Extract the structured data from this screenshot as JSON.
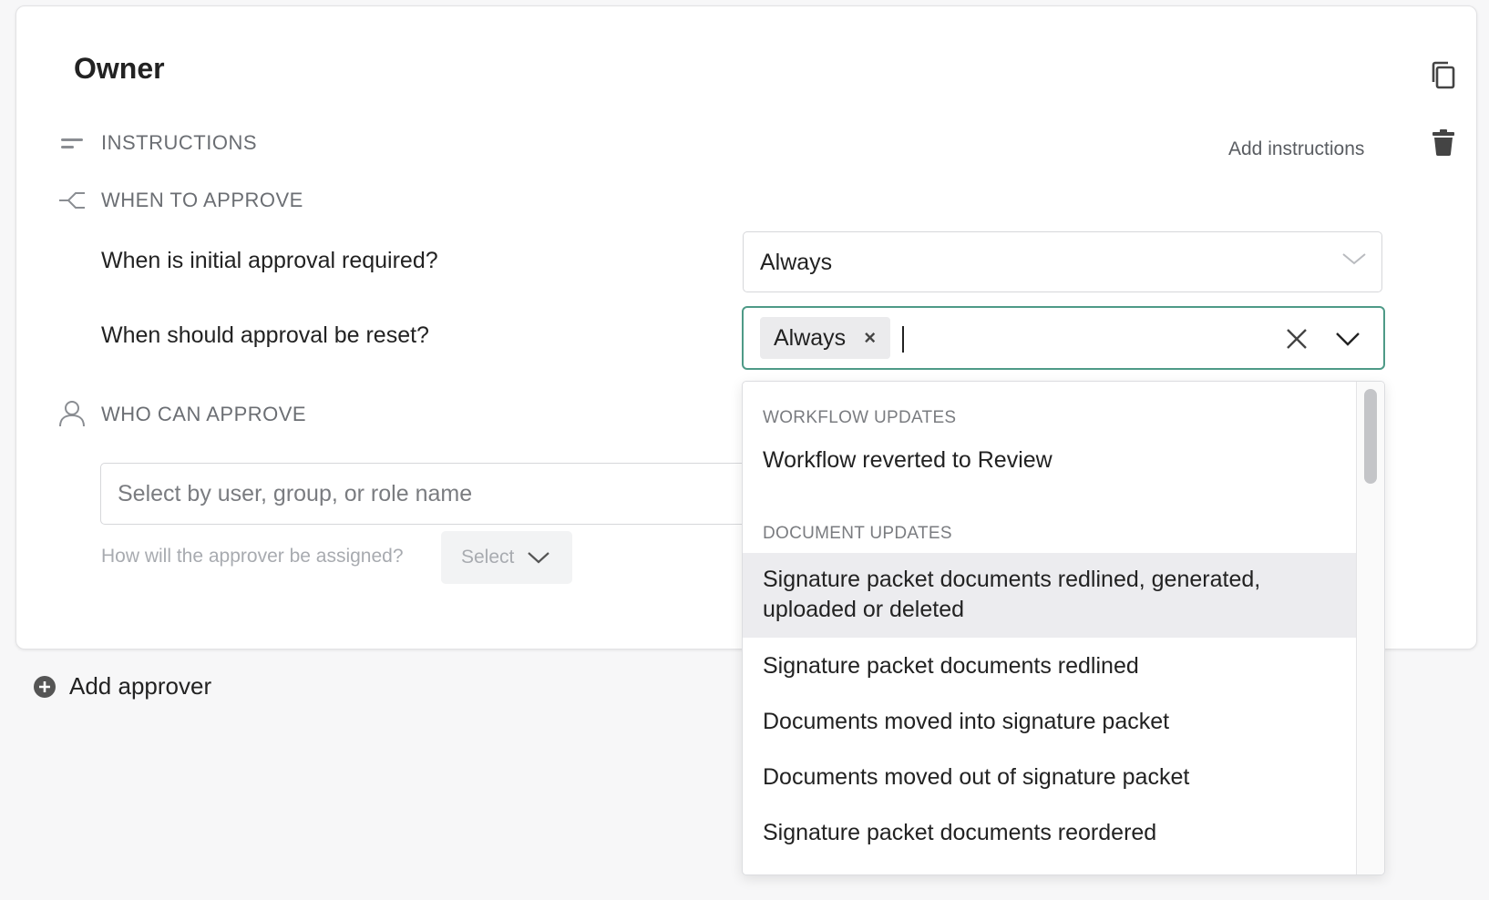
{
  "card": {
    "title": "Owner",
    "add_instructions_label": "Add instructions"
  },
  "sections": {
    "instructions": "INSTRUCTIONS",
    "when_to_approve": "WHEN TO APPROVE",
    "who_can_approve": "WHO CAN APPROVE"
  },
  "when_to_approve": {
    "initial_question": "When is initial approval required?",
    "initial_value": "Always",
    "reset_question": "When should approval be reset?",
    "reset_selected": [
      "Always"
    ]
  },
  "who_can_approve": {
    "search_placeholder": "Select by user, group, or role name",
    "assign_question": "How will the approver be assigned?",
    "assign_select_label": "Select"
  },
  "footer": {
    "add_approver_label": "Add approver"
  },
  "dropdown": {
    "groups": [
      {
        "label": "WORKFLOW UPDATES",
        "items": [
          "Workflow reverted to Review"
        ]
      },
      {
        "label": "DOCUMENT UPDATES",
        "items": [
          "Signature packet documents redlined, generated, uploaded or deleted",
          "Signature packet documents redlined",
          "Documents moved into signature packet",
          "Documents moved out of signature packet",
          "Signature packet documents reordered"
        ]
      }
    ],
    "highlighted_item": "Signature packet documents redlined, generated, uploaded or deleted"
  },
  "colors": {
    "focus_border": "#4e9a87",
    "highlight_bg": "#ececef",
    "chip_bg": "#ebebed"
  },
  "icons": {
    "copy": "copy-icon",
    "trash": "trash-icon",
    "instructions": "lines-icon",
    "when_to_approve": "branch-icon",
    "who_can_approve": "user-icon",
    "add": "plus-circle-icon"
  }
}
